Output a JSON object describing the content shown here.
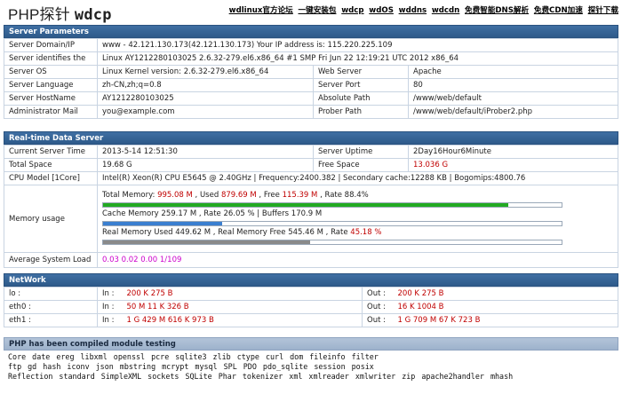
{
  "header": {
    "title_a": "PHP探针",
    "title_b": "wdcp",
    "links": [
      "wdlinux官方论坛",
      "一键安装包",
      "wdcp",
      "wdOS",
      "wddns",
      "wdcdn",
      "免费智能DNS解析",
      "免费CDN加速",
      "探针下载"
    ]
  },
  "server_params": {
    "title": "Server Parameters",
    "domain_label": "Server Domain/IP",
    "domain_value": "www - 42.121.130.173(42.121.130.173)  Your IP address is: 115.220.225.109",
    "identifies_label": "Server identifies the",
    "identifies_value": "Linux AY1212280103025 2.6.32-279.el6.x86_64 #1 SMP Fri Jun 22 12:19:21 UTC 2012 x86_64",
    "os_label": "Server OS",
    "os_value": "Linux  Kernel version: 2.6.32-279.el6.x86_64",
    "web_server_label": "Web Server",
    "web_server_value": "Apache",
    "language_label": "Server Language",
    "language_value": "zh-CN,zh;q=0.8",
    "port_label": "Server Port",
    "port_value": "80",
    "hostname_label": "Server HostName",
    "hostname_value": "AY1212280103025",
    "abs_path_label": "Absolute Path",
    "abs_path_value": "/www/web/default",
    "admin_mail_label": "Administrator Mail",
    "admin_mail_value": "you@example.com",
    "prober_path_label": "Prober Path",
    "prober_path_value": "/www/web/default/iProber2.php"
  },
  "realtime": {
    "title": "Real-time Data Server",
    "current_time_label": "Current Server Time",
    "current_time_value": "2013-5-14 12:51:30",
    "uptime_label": "Server Uptime",
    "uptime_value": "2Day16Hour6Minute",
    "total_space_label": "Total Space",
    "total_space_value": "19.68 G",
    "free_space_label": "Free Space",
    "free_space_value": "13.036 G",
    "cpu_label": "CPU Model [1Core]",
    "cpu_value": "Intel(R) Xeon(R) CPU E5645 @ 2.40GHz | Frequency:2400.382 | Secondary cache:12288 KB | Bogomips:4800.76",
    "memory_label": "Memory usage",
    "mem_total_prefix": "Total Memory: ",
    "mem_total": "995.08 M",
    "mem_used_prefix": " , Used ",
    "mem_used": "879.69 M",
    "mem_free_prefix": " , Free ",
    "mem_free": "115.39 M",
    "mem_rate": " , Rate 88.4%",
    "mem_rate_value": 88.4,
    "mem_color": "#22aa22",
    "cache_text": "Cache Memory 259.17 M , Rate 26.05 % | Buffers 170.9 M",
    "cache_rate_value": 26.05,
    "cache_color": "#3a7fd0",
    "real_prefix": "Real Memory Used 449.62 M , Real Memory Free 545.46 M , Rate ",
    "real_rate": "45.18 %",
    "real_rate_value": 45.18,
    "real_color": "#8a8a8a",
    "load_label": "Average System Load",
    "load_value": "0.03 0.02 0.00 1/109"
  },
  "network": {
    "title": "NetWork",
    "rows": [
      {
        "iface": "lo :",
        "in_label": "In :",
        "in_value": "200 K   275 B",
        "out_label": "Out :",
        "out_value": "200 K   275 B"
      },
      {
        "iface": "eth0 :",
        "in_label": "In :",
        "in_value": "50 M    11 K   326 B",
        "out_label": "Out :",
        "out_value": "16 K 1004 B"
      },
      {
        "iface": "eth1 :",
        "in_label": "In :",
        "in_value": "1 G   429 M   616 K   973 B",
        "out_label": "Out :",
        "out_value": "1 G   709 M    67 K   723 B"
      }
    ]
  },
  "php_modules": {
    "title": "PHP has been compiled module testing",
    "line1": [
      "Core",
      "date",
      "ereg",
      "libxml",
      "openssl",
      "pcre",
      "sqlite3",
      "zlib",
      "ctype",
      "curl",
      "dom",
      "fileinfo",
      "filter"
    ],
    "line2": [
      "ftp",
      "gd",
      "hash",
      "iconv",
      "json",
      "mbstring",
      "mcrypt",
      "mysql",
      "SPL",
      "PDO",
      "pdo_sqlite",
      "session",
      "posix"
    ],
    "line3": [
      "Reflection",
      "standard",
      "SimpleXML",
      "sockets",
      "SQLite",
      "Phar",
      "tokenizer",
      "xml",
      "xmlreader",
      "xmlwriter",
      "zip",
      "apache2handler",
      "mhash"
    ]
  }
}
